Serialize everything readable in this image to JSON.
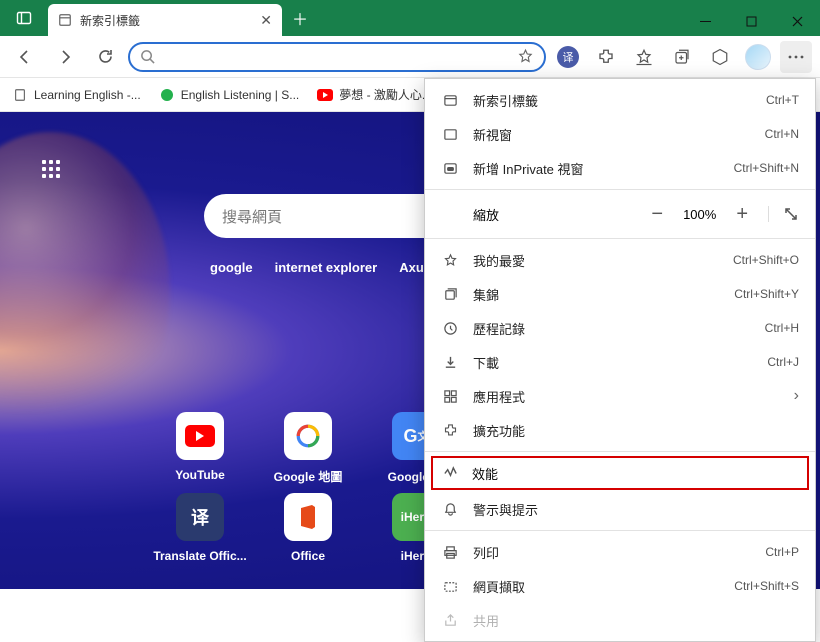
{
  "titlebar": {
    "tab_title": "新索引標籤"
  },
  "toolbar": {
    "search_placeholder": ""
  },
  "bookmarks": {
    "items": [
      {
        "label": "Learning English -..."
      },
      {
        "label": "English Listening | S..."
      },
      {
        "label": "夢想 - 激勵人心..."
      }
    ]
  },
  "ntp": {
    "search_placeholder": "搜尋網頁",
    "suggestions": [
      "google",
      "internet explorer",
      "Axure Software"
    ],
    "tiles_row1": [
      {
        "label": "YouTube"
      },
      {
        "label": "Google 地圖"
      },
      {
        "label": "Google 翻"
      }
    ],
    "tiles_row2": [
      {
        "label": "Translate Offic..."
      },
      {
        "label": "Office"
      },
      {
        "label": "iHerb"
      }
    ]
  },
  "menu": {
    "new_tab": "新索引標籤",
    "new_tab_sc": "Ctrl+T",
    "new_window": "新視窗",
    "new_window_sc": "Ctrl+N",
    "new_inprivate": "新增 InPrivate 視窗",
    "new_inprivate_sc": "Ctrl+Shift+N",
    "zoom_label": "縮放",
    "zoom_value": "100%",
    "favorites": "我的最愛",
    "favorites_sc": "Ctrl+Shift+O",
    "collections": "集錦",
    "collections_sc": "Ctrl+Shift+Y",
    "history": "歷程記錄",
    "history_sc": "Ctrl+H",
    "downloads": "下載",
    "downloads_sc": "Ctrl+J",
    "apps": "應用程式",
    "extensions": "擴充功能",
    "performance": "效能",
    "alerts": "警示與提示",
    "print": "列印",
    "print_sc": "Ctrl+P",
    "capture": "網頁擷取",
    "capture_sc": "Ctrl+Shift+S",
    "share": "共用"
  }
}
